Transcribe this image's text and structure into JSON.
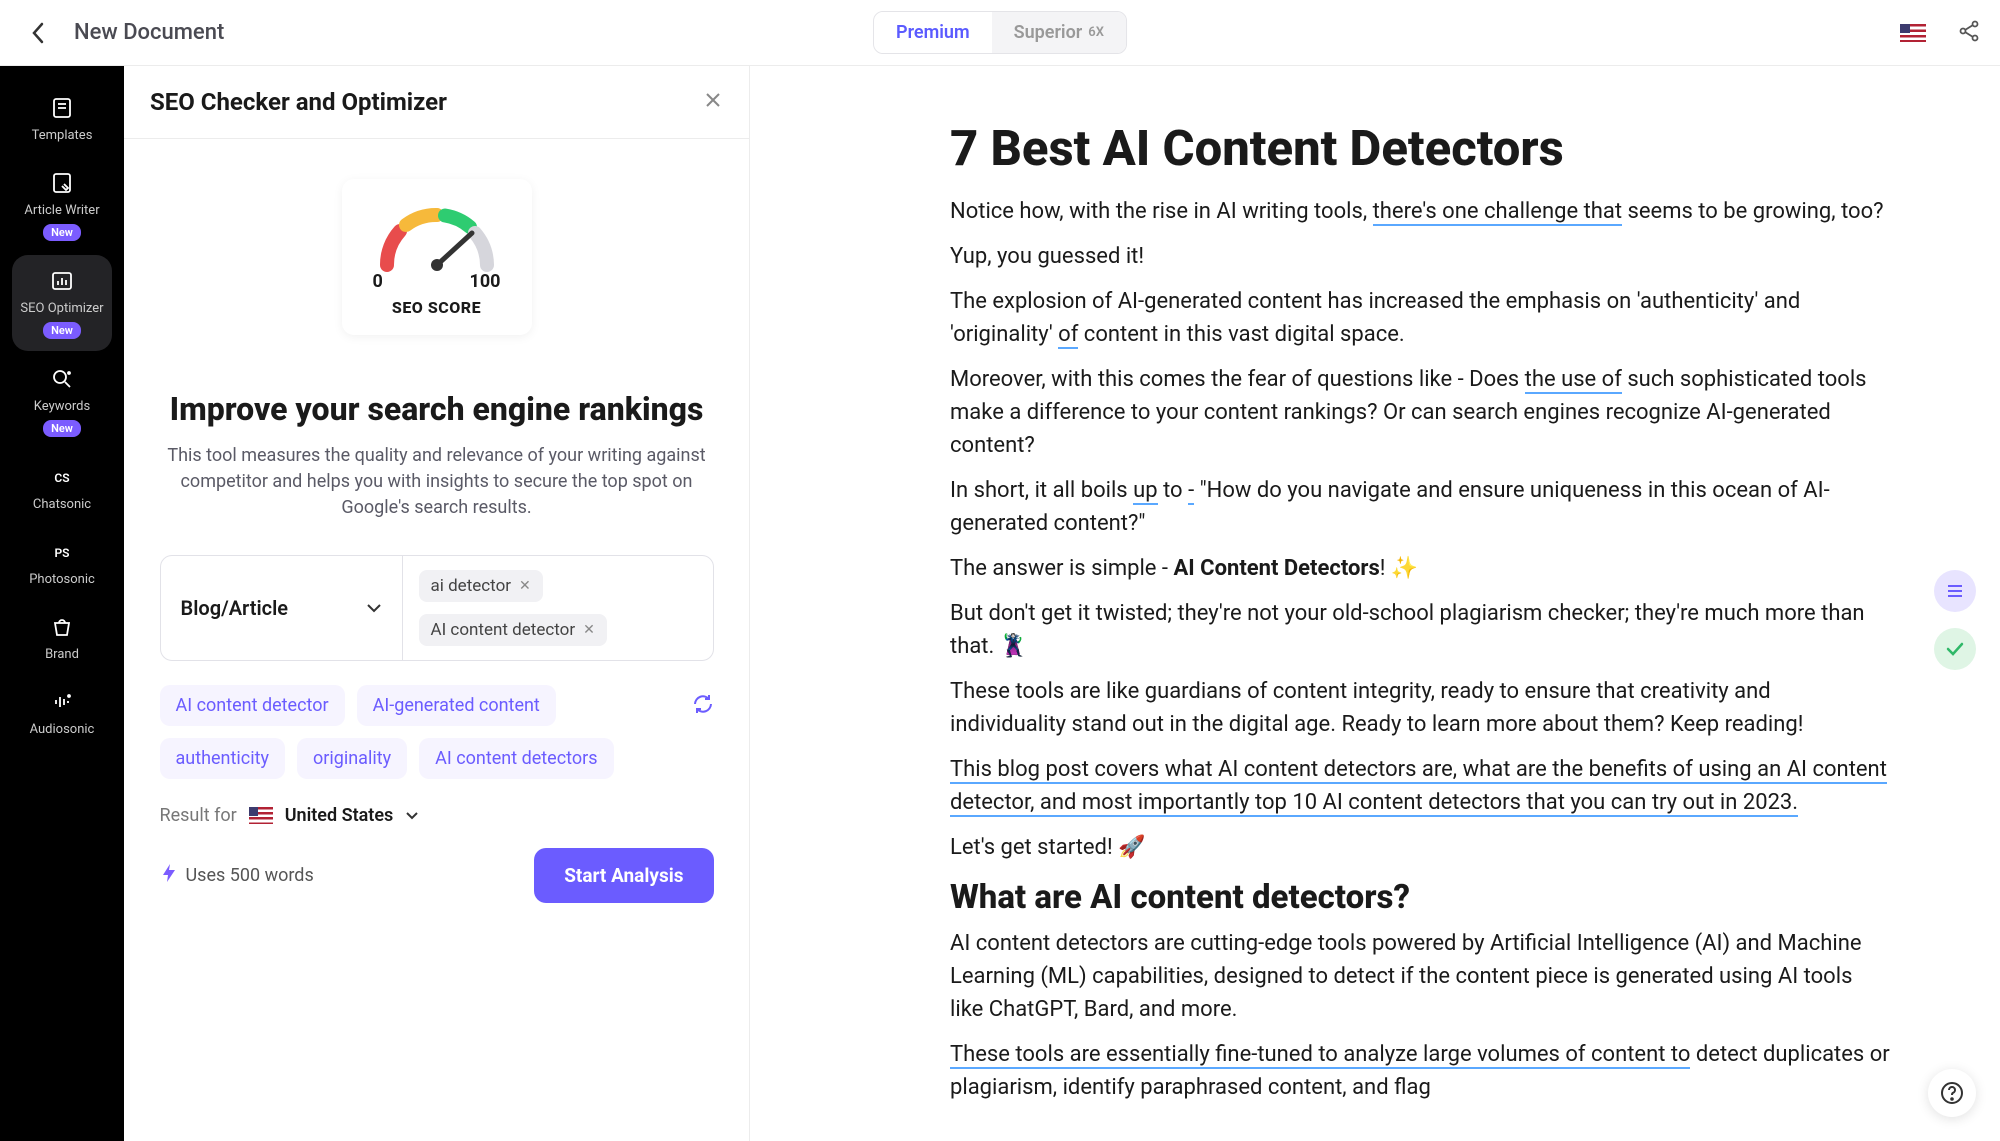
{
  "header": {
    "doc_title": "New Document",
    "premium_label": "Premium",
    "superior_label": "Superior",
    "superior_badge": "6X"
  },
  "sidebar": {
    "items": [
      {
        "label": "Templates",
        "badge": null
      },
      {
        "label": "Article Writer",
        "badge": "New"
      },
      {
        "label": "SEO Optimizer",
        "badge": "New"
      },
      {
        "label": "Keywords",
        "badge": "New"
      },
      {
        "label": "Chatsonic",
        "badge": null
      },
      {
        "label": "Photosonic",
        "badge": null
      },
      {
        "label": "Brand",
        "badge": null
      },
      {
        "label": "Audiosonic",
        "badge": null
      }
    ]
  },
  "seo": {
    "panel_title": "SEO Checker and Optimizer",
    "gauge_min": "0",
    "gauge_max": "100",
    "gauge_label": "SEO SCORE",
    "heading": "Improve your search engine rankings",
    "description": "This tool measures the quality and relevance of your writing against competitor and helps you with insights to secure the top spot on Google's search results.",
    "content_type": "Blog/Article",
    "tags": [
      "ai detector",
      "AI content detector"
    ],
    "suggestions": [
      "AI content detector",
      "AI-generated content",
      "authenticity",
      "originality",
      "AI content detectors"
    ],
    "result_for_label": "Result for",
    "country": "United States",
    "uses_words": "Uses 500 words",
    "start_button": "Start Analysis"
  },
  "article": {
    "title": "7 Best AI Content Detectors",
    "p1_a": "Notice how, with the rise in AI writing tools, ",
    "p1_link": "there's one challenge that",
    "p1_b": " seems to be growing, too?",
    "p2": "Yup, you guessed it!",
    "p3_a": "The explosion of AI-generated content has increased the emphasis on 'authenticity' and 'originality' ",
    "p3_link": "of",
    "p3_b": " content in this vast digital space.",
    "p4_a": "Moreover, with this comes the fear of questions like - Does ",
    "p4_link": "the use of",
    "p4_b": " such sophisticated tools make a difference to your content rankings? Or can search engines recognize AI-generated content?",
    "p5_a": "In short, it all boils ",
    "p5_link1": "up",
    "p5_mid": " to ",
    "p5_link2": "-",
    "p5_b": " \"How do you navigate and ensure uniqueness in this ocean of AI-generated content?\"",
    "p6_a": "The answer is simple - ",
    "p6_strong": "AI Content Detectors",
    "p6_b": "! ✨",
    "p7": "But don't get it twisted; they're not your old-school plagiarism checker; they're much more than that. 🦹",
    "p8": "These tools are like guardians of content integrity, ready to ensure that creativity and individuality stand out in the digital age. Ready to learn more about them? Keep reading!",
    "p9": "This blog post covers what AI content detectors are, what are the benefits of using an AI content detector, and most importantly top 10 AI content detectors that you can try out in 2023.",
    "p10": "Let's get started! 🚀",
    "h2": "What are AI content detectors?",
    "p11": "AI content detectors are cutting-edge tools powered by Artificial Intelligence (AI) and Machine Learning (ML) capabilities, designed to detect if the content piece is generated using AI tools like ChatGPT, Bard, and more.",
    "p12_a": "These tools are essentially fine-tuned to analyze large volumes of content to",
    "p12_b": " detect duplicates or plagiarism, identify paraphrased content, and flag"
  }
}
